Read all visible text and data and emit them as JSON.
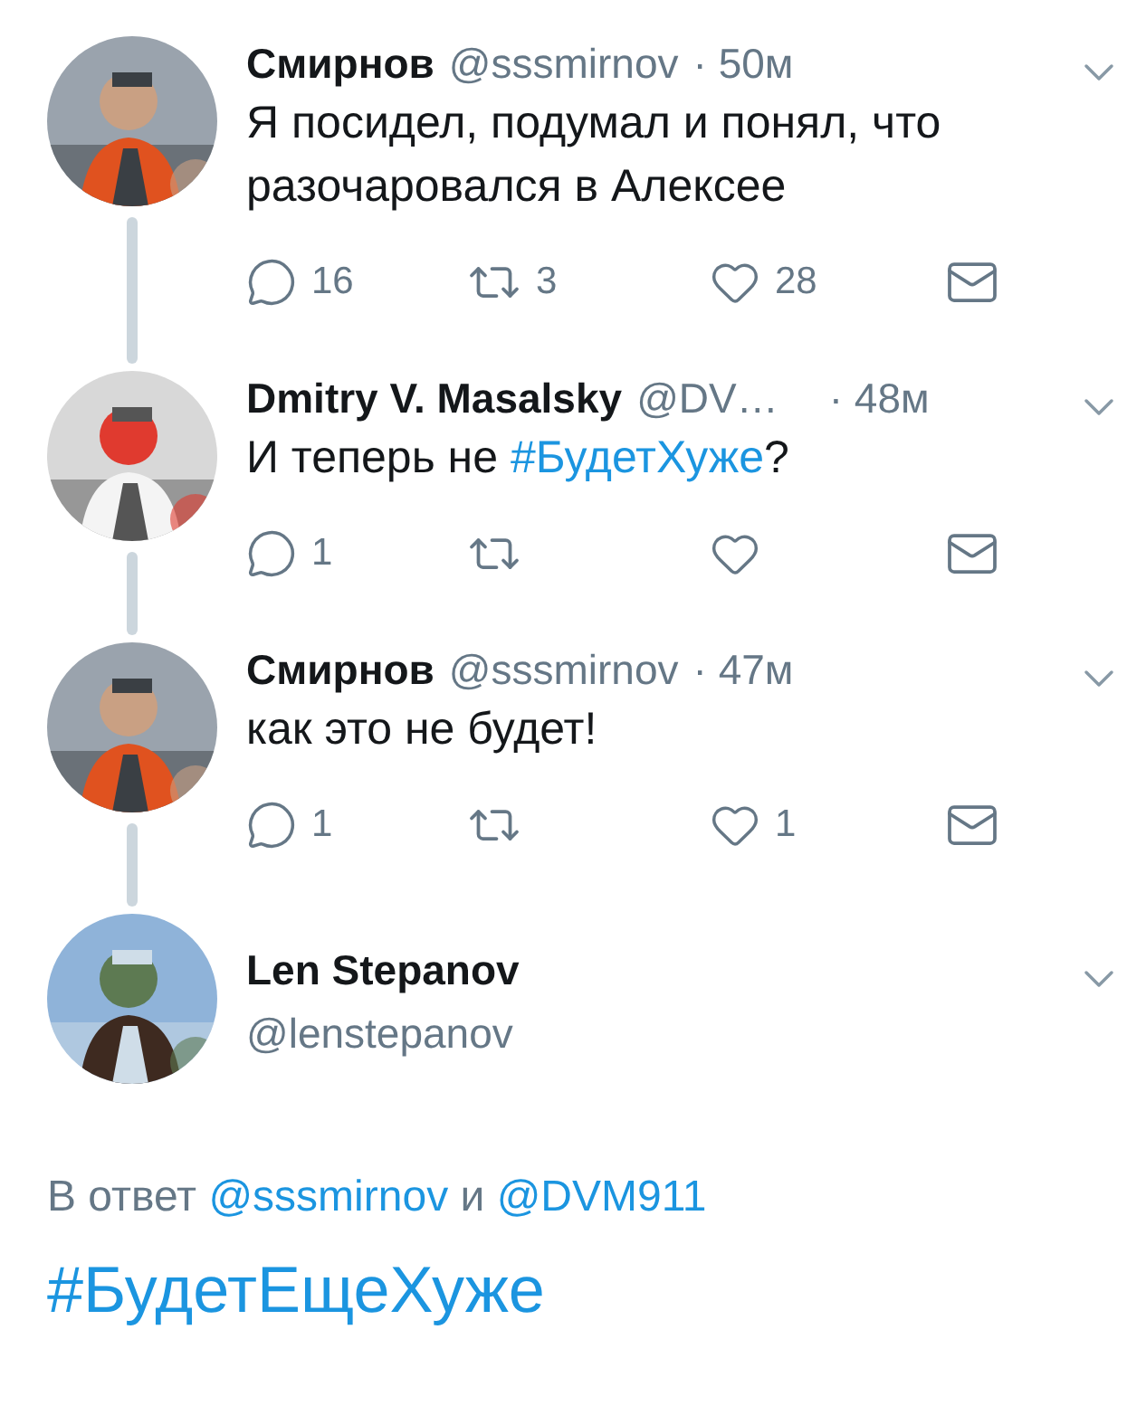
{
  "thread": [
    {
      "kind": "reply",
      "name": "Смирнов",
      "handle": "@sssmirnov",
      "time": "· 50м",
      "text": [
        {
          "kind": "text",
          "value": "Я посидел, подумал и понял, что разочаровался в Алексее"
        }
      ],
      "replies": "16",
      "retweets": "3",
      "likes": "28",
      "avatar": {
        "kind": "picture"
      }
    },
    {
      "kind": "reply",
      "name": "Dmitry V. Masalsky",
      "handle": "@DV…",
      "time": "· 48м",
      "text": [
        {
          "kind": "text",
          "value": "И теперь не "
        },
        {
          "kind": "hashtag",
          "value": "#БудетХуже"
        },
        {
          "kind": "text",
          "value": "?"
        }
      ],
      "replies": "1",
      "avatar": {
        "kind": "picture"
      }
    },
    {
      "kind": "reply",
      "name": "Смирнов",
      "handle": "@sssmirnov",
      "time": "· 47м",
      "text": [
        {
          "kind": "text",
          "value": "как это не будет!"
        }
      ],
      "replies": "1",
      "likes": "1",
      "avatar": {
        "kind": "picture"
      }
    },
    {
      "kind": "main",
      "name": "Len Stepanov",
      "handle": "@lenstepanov",
      "avatar": {
        "kind": "picture"
      }
    }
  ],
  "reply_to": [
    {
      "kind": "text",
      "value": "В ответ "
    },
    {
      "kind": "mention",
      "value": "@sssmirnov"
    },
    {
      "kind": "text",
      "value": " и "
    },
    {
      "kind": "mention",
      "value": "@DVM911"
    }
  ],
  "main_text": [
    {
      "kind": "hashtag",
      "value": "#БудетЕщеХуже"
    }
  ]
}
